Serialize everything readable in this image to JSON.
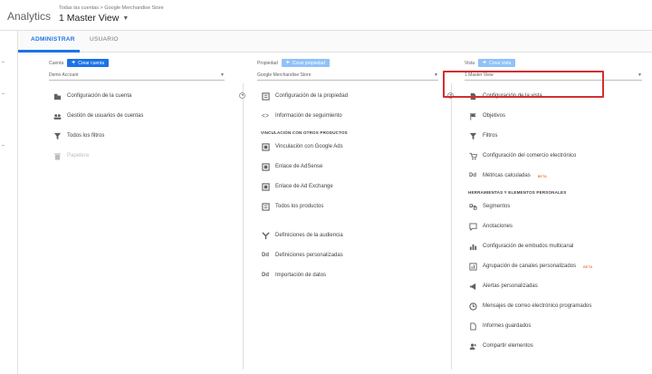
{
  "header": {
    "brand": "Analytics",
    "breadcrumb": "Todas las cuentas > Google Merchandise Store",
    "view_name": "1 Master View"
  },
  "tabs": [
    {
      "label": "ADMINISTRAR",
      "active": true
    },
    {
      "label": "USUARIO",
      "active": false
    }
  ],
  "account": {
    "label": "Cuenta",
    "create_label": "Crear cuenta",
    "selected": "Demo Account",
    "items": [
      {
        "label": "Configuración de la cuenta",
        "icon": "building-icon"
      },
      {
        "label": "Gestión de usuarios de cuentas",
        "icon": "users-icon"
      },
      {
        "label": "Todos los filtros",
        "icon": "filter-icon"
      },
      {
        "label": "Papelera",
        "icon": "trash-icon"
      }
    ]
  },
  "property": {
    "label": "Propiedad",
    "create_label": "Crear propiedad",
    "selected": "Google Merchandise Store",
    "items": [
      {
        "label": "Configuración de la propiedad",
        "icon": "property-icon"
      },
      {
        "label": "Información de seguimiento",
        "icon": "code-icon"
      }
    ],
    "section_title": "VINCULACIÓN CON OTROS PRODUCTOS",
    "linked": [
      {
        "label": "Vinculación con Google Ads",
        "icon": "ads-icon"
      },
      {
        "label": "Enlace de AdSense",
        "icon": "adsense-icon"
      },
      {
        "label": "Enlace de Ad Exchange",
        "icon": "adexchange-icon"
      },
      {
        "label": "Todos los productos",
        "icon": "products-icon"
      }
    ],
    "extra": [
      {
        "label": "Definiciones de la audiencia",
        "icon": "audience-icon"
      },
      {
        "label": "Definiciones personalizadas",
        "icon": "dd-icon",
        "abbr": "Dd"
      },
      {
        "label": "Importación de datos",
        "icon": "dd-icon",
        "abbr": "Dd"
      }
    ]
  },
  "view": {
    "label": "Vista",
    "create_label": "Crear vista",
    "selected": "1 Master View",
    "items": [
      {
        "label": "Configuración de la vista",
        "icon": "document-icon"
      },
      {
        "label": "Objetivos",
        "icon": "flag-icon"
      },
      {
        "label": "Filtros",
        "icon": "filter-icon"
      },
      {
        "label": "Configuración del comercio electrónico",
        "icon": "cart-icon"
      },
      {
        "label": "Métricas calculadas",
        "icon": "dd-icon",
        "abbr": "Dd",
        "badge": "BETA"
      }
    ],
    "section_title": "HERRAMIENTAS Y ELEMENTOS PERSONALES",
    "tools": [
      {
        "label": "Segmentos",
        "icon": "segments-icon"
      },
      {
        "label": "Anotaciones",
        "icon": "annotations-icon"
      },
      {
        "label": "Configuración de embudos multicanal",
        "icon": "bar-chart-icon"
      },
      {
        "label": "Agrupación de canales personalizados",
        "icon": "channels-icon",
        "badge": "BETA"
      },
      {
        "label": "Alertas personalizadas",
        "icon": "megaphone-icon"
      },
      {
        "label": "Mensajes de correo electrónico programados",
        "icon": "clock-icon"
      },
      {
        "label": "Informes guardados",
        "icon": "report-icon"
      },
      {
        "label": "Compartir elementos",
        "icon": "share-user-icon"
      }
    ]
  },
  "colors": {
    "accent": "#1a73e8",
    "highlight": "#d32f2f",
    "beta": "#e65100"
  }
}
